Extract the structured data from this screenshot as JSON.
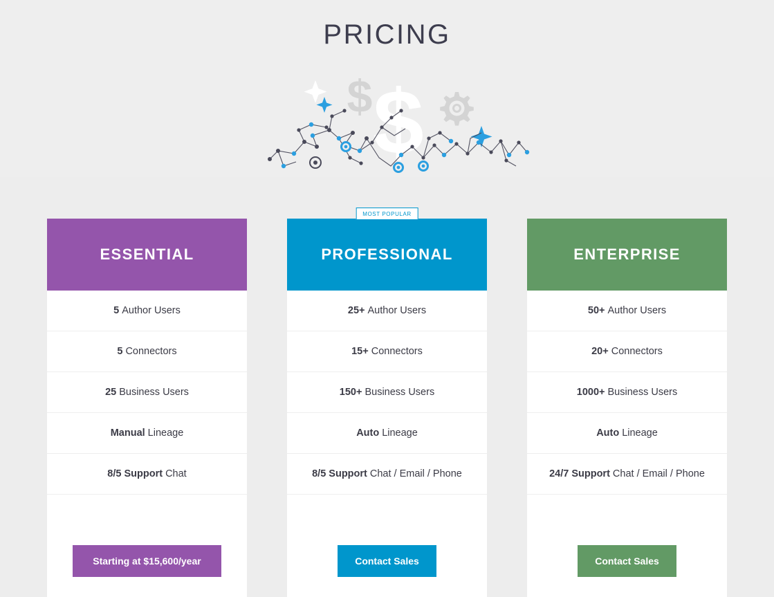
{
  "page": {
    "title": "PRICING",
    "background": "#efefef",
    "hero_background": "#eeeeee"
  },
  "hero_art": {
    "name": "pricing-network-illustration",
    "elements": [
      "dollar-sign-large",
      "dollar-sign-small",
      "gear-icon",
      "sparkle-white",
      "sparkle-blue-small",
      "sparkle-blue-large",
      "node-network"
    ],
    "colors": {
      "node_dark": "#4a4a5a",
      "node_blue": "#2b9fe0",
      "glyph_gray": "#d6d6d6",
      "glyph_white": "#ffffff"
    }
  },
  "colors": {
    "essential": "#9455ab",
    "professional": "#0096cc",
    "enterprise": "#629a65",
    "card_background": "#ffffff",
    "divider": "#eeeeee",
    "text": "#3b3b46"
  },
  "plans": [
    {
      "id": "essential",
      "name": "ESSENTIAL",
      "accent": "#9455ab",
      "badge": null,
      "features": [
        {
          "lead": "5",
          "rest": "Author Users"
        },
        {
          "lead": "5",
          "rest": "Connectors"
        },
        {
          "lead": "25",
          "rest": "Business Users"
        },
        {
          "lead": "Manual",
          "rest": "Lineage"
        },
        {
          "lead": "8/5 Support",
          "rest": "Chat"
        }
      ],
      "cta": "Starting at $15,600/year"
    },
    {
      "id": "professional",
      "name": "PROFESSIONAL",
      "accent": "#0096cc",
      "badge": "MOST POPULAR",
      "features": [
        {
          "lead": "25+",
          "rest": "Author Users"
        },
        {
          "lead": "15+",
          "rest": "Connectors"
        },
        {
          "lead": "150+",
          "rest": "Business Users"
        },
        {
          "lead": "Auto",
          "rest": "Lineage"
        },
        {
          "lead": "8/5 Support",
          "rest": "Chat / Email / Phone"
        }
      ],
      "cta": "Contact Sales"
    },
    {
      "id": "enterprise",
      "name": "ENTERPRISE",
      "accent": "#629a65",
      "badge": null,
      "features": [
        {
          "lead": "50+",
          "rest": "Author Users"
        },
        {
          "lead": "20+",
          "rest": "Connectors"
        },
        {
          "lead": "1000+",
          "rest": "Business Users"
        },
        {
          "lead": "Auto",
          "rest": "Lineage"
        },
        {
          "lead": "24/7 Support",
          "rest": "Chat / Email / Phone"
        }
      ],
      "cta": "Contact Sales"
    }
  ]
}
